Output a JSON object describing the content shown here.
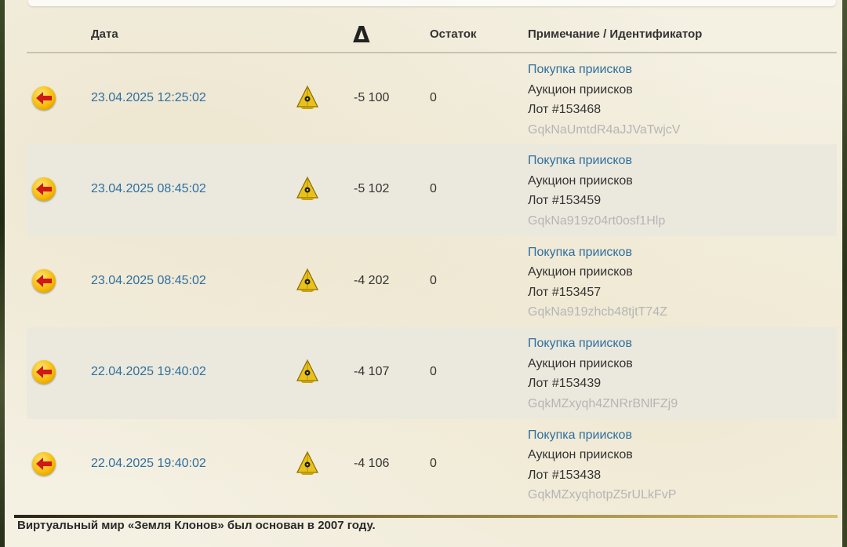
{
  "table": {
    "headers": {
      "date": "Дата",
      "delta": "Δ",
      "balance": "Остаток",
      "note": "Примечание / Идентификатор"
    },
    "rows": [
      {
        "date": "23.04.2025 12:25:02",
        "amount": "-5 100",
        "balance": "0",
        "note_link": "Покупка приисков",
        "note_line1": "Аукцион приисков",
        "note_line2": "Лот #153468",
        "id": "GqkNaUmtdR4aJJVaTwjcV"
      },
      {
        "date": "23.04.2025 08:45:02",
        "amount": "-5 102",
        "balance": "0",
        "note_link": "Покупка приисков",
        "note_line1": "Аукцион приисков",
        "note_line2": "Лот #153459",
        "id": "GqkNa919z04rt0osf1Hlp"
      },
      {
        "date": "23.04.2025 08:45:02",
        "amount": "-4 202",
        "balance": "0",
        "note_link": "Покупка приисков",
        "note_line1": "Аукцион приисков",
        "note_line2": "Лот #153457",
        "id": "GqkNa919zhcb48tjtT74Z"
      },
      {
        "date": "22.04.2025 19:40:02",
        "amount": "-4 107",
        "balance": "0",
        "note_link": "Покупка приисков",
        "note_line1": "Аукцион приисков",
        "note_line2": "Лот #153439",
        "id": "GqkMZxyqh4ZNRrBNlFZj9"
      },
      {
        "date": "22.04.2025 19:40:02",
        "amount": "-4 106",
        "balance": "0",
        "note_link": "Покупка приисков",
        "note_line1": "Аукцион приисков",
        "note_line2": "Лот #153438",
        "id": "GqkMZxyqhotpZ5rULkFvP"
      }
    ]
  },
  "footer": {
    "text": "Виртуальный мир «Земля Клонов» был основан в 2007 году."
  },
  "icons": {
    "row_action": "back-arrow-icon",
    "currency": "pyramid-coin-icon"
  },
  "colors": {
    "link": "#2f6f9f",
    "id_text": "#b5b5b5",
    "alt_row": "#ebe9dd",
    "parchment": "#f4f0e2"
  }
}
